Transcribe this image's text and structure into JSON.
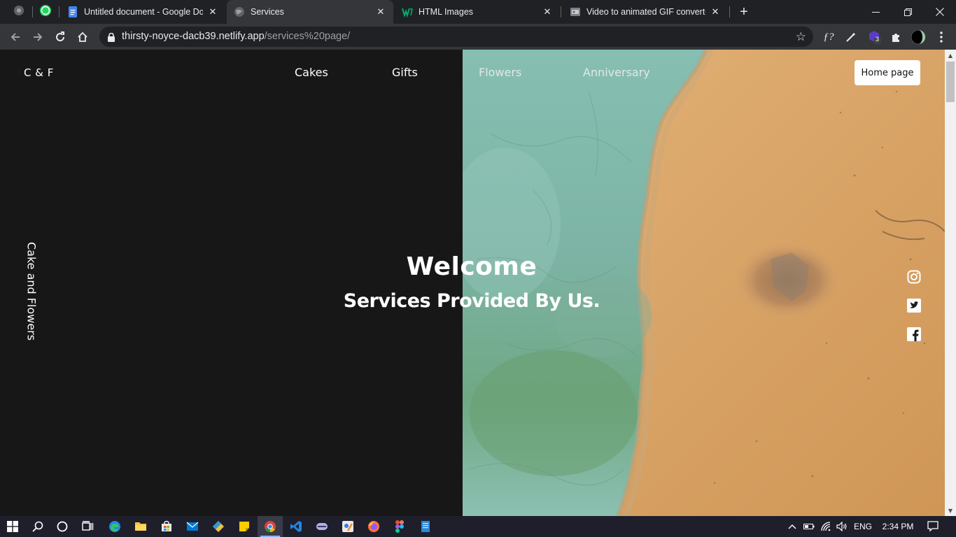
{
  "browser": {
    "tabs": [
      {
        "title": "Untitled document - Google Doc",
        "favicon": "google-docs-icon",
        "active": false
      },
      {
        "title": "Services",
        "favicon": "globe-icon",
        "active": true
      },
      {
        "title": "HTML Images",
        "favicon": "w3schools-icon",
        "active": false
      },
      {
        "title": "Video to animated GIF converter",
        "favicon": "ezgif-icon",
        "active": false
      }
    ],
    "pinned_tabs": [
      "chrome-icon",
      "whatsapp-icon"
    ],
    "address": {
      "host": "thirsty-noyce-dacb39.netlify.app",
      "path": "/services%20page/"
    },
    "extension_badge": "3",
    "extension_fx": "ƒ?"
  },
  "page": {
    "brand": "C & F",
    "nav": [
      "Cakes",
      "Gifts",
      "Flowers",
      "Anniversary"
    ],
    "home_button": "Home page",
    "side_text": "Cake and Flowers",
    "welcome": "Welcome",
    "subtitle": "Services Provided By Us.",
    "social": [
      "instagram-icon",
      "twitter-icon",
      "facebook-icon"
    ],
    "colors": {
      "background": "#171717",
      "text": "#ffffff",
      "water": "#7fb3a6",
      "sand": "#d9a467"
    }
  },
  "taskbar": {
    "language": "ENG",
    "time": "2:34 PM",
    "apps": [
      "edge-icon",
      "file-explorer-icon",
      "store-icon",
      "mail-icon",
      "git-icon",
      "sticky-notes-icon",
      "chrome-icon",
      "vscode-icon",
      "app-icon",
      "paint-icon",
      "firefox-icon",
      "figma-icon",
      "notepad-icon"
    ]
  }
}
